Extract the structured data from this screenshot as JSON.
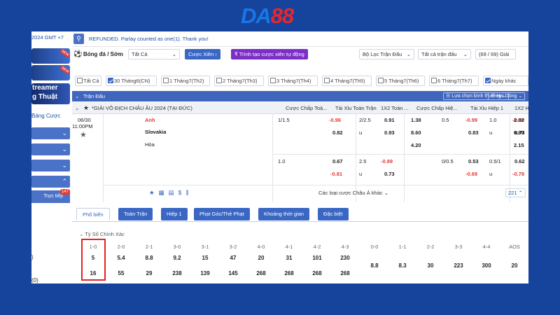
{
  "logo": {
    "part1": "DA",
    "part2": "88"
  },
  "sidebar": {
    "time": "2024 GMT +7",
    "banner_text_1": "treamer",
    "banner_text_2": "g Thuật",
    "new_badge": "NEW",
    "bang_cuoc": "Bảng Cược",
    "live_label": "Trực tiếp",
    "live_count": "147",
    "mark1": ")",
    "mark2": "(0)"
  },
  "topbar": {
    "notice": "REFUNDED. Parlay counted as one(1). Thank you!"
  },
  "filters": {
    "sport": "Bóng đá / Sớm",
    "all": "Tất Cả",
    "parlay": "Cược Xiên",
    "auto_parlay": "Trình tạo cược xiên tự động",
    "league_filter": "Bộ Lọc Trận Đấu",
    "all_matches": "Tất cả trận đấu",
    "league_count": "(69 / 69) Giải"
  },
  "date_tabs": [
    {
      "label": "Tất Cả",
      "checked": false
    },
    {
      "label": "30 Tháng6(CN)",
      "checked": true
    },
    {
      "label": "1 Tháng7(Th2)",
      "checked": false
    },
    {
      "label": "2 Tháng7(Th3)",
      "checked": false
    },
    {
      "label": "3 Tháng7(Th4)",
      "checked": false
    },
    {
      "label": "4 Tháng7(Th5)",
      "checked": false
    },
    {
      "label": "5 Tháng7(Th6)",
      "checked": false
    },
    {
      "label": "6 Tháng7(Th7)",
      "checked": false
    },
    {
      "label": "Ngày khác",
      "checked": true
    }
  ],
  "header": {
    "title": "Trận Đấu",
    "sort": "Lựa chọn bình thường",
    "view": "Hai Dòng"
  },
  "columns": {
    "league": "*GIẢI VÔ ĐỊCH CHÂU ÂU 2024 (TẠI ĐỨC)",
    "c1": "Cược Chấp Toà...",
    "c2": "Tài Xỉu Toàn Trận",
    "c3": "1X2 Toàn ...",
    "c4": "Cược Chấp Hiệ...",
    "c5": "Tài Xỉu Hiệp 1",
    "c6": "1X2 Hiệp"
  },
  "match": {
    "date": "06/30",
    "time": "11:00PM",
    "home": "Anh",
    "away": "Slovakia",
    "draw": "Hòa",
    "row1": {
      "hcp": "1/1.5",
      "hcp_home": "-0.96",
      "ou": "2/2.5",
      "ou_over": "0.91",
      "x12_home": "1.38",
      "h1_hcp": "0.5",
      "h1_hcp_home": "-0.99",
      "h1_ou": "1.0",
      "h1_ou_over": "-0.89",
      "h1_x12_home": "2.02"
    },
    "row2": {
      "hcp_away": "0.82",
      "ou_u": "u",
      "ou_under": "0.93",
      "x12_away": "8.60",
      "h1_hcp_away": "0.83",
      "h1_ou_u": "u",
      "h1_ou_under": "0.73",
      "h1_x12_away": "6.90"
    },
    "row3": {
      "x12_draw": "4.20",
      "h1_x12_draw": "2.15"
    },
    "alt1": {
      "hcp": "1.0",
      "hcp_home": "0.67",
      "ou": "2.5",
      "ou_over": "-0.89",
      "h1_hcp": "0/0.5",
      "h1_hcp_home": "0.53",
      "h1_ou": "0.5/1",
      "h1_ou_over": "0.62"
    },
    "alt2": {
      "hcp_away": "-0.81",
      "ou_u": "u",
      "ou_under": "0.73",
      "h1_hcp_away": "-0.69",
      "h1_ou_u": "u",
      "h1_ou_under": "-0.78"
    },
    "more_asian": "Các loại cược Châu Á khác",
    "more_count": "221"
  },
  "tabs": [
    "Phổ biến",
    "Toàn Trận",
    "Hiệp 1",
    "Phạt Góc/Thẻ Phạt",
    "Khoảng thời gian",
    "Đặc biệt"
  ],
  "correct_score": {
    "title": "Tỷ Số Chính Xác",
    "headers": [
      "1-0",
      "2-0",
      "2-1",
      "3-0",
      "3-1",
      "3-2",
      "4-0",
      "4-1",
      "4-2",
      "4-3",
      "0-0",
      "1-1",
      "2-2",
      "3-3",
      "4-4",
      "AOS"
    ],
    "home_values": [
      "5",
      "5.4",
      "8.8",
      "9.2",
      "15",
      "47",
      "20",
      "31",
      "101",
      "230"
    ],
    "away_values": [
      "16",
      "55",
      "29",
      "238",
      "139",
      "145",
      "268",
      "268",
      "268",
      "268"
    ],
    "draw_values": [
      "8.8",
      "8.3",
      "30",
      "223",
      "300",
      "20"
    ]
  }
}
